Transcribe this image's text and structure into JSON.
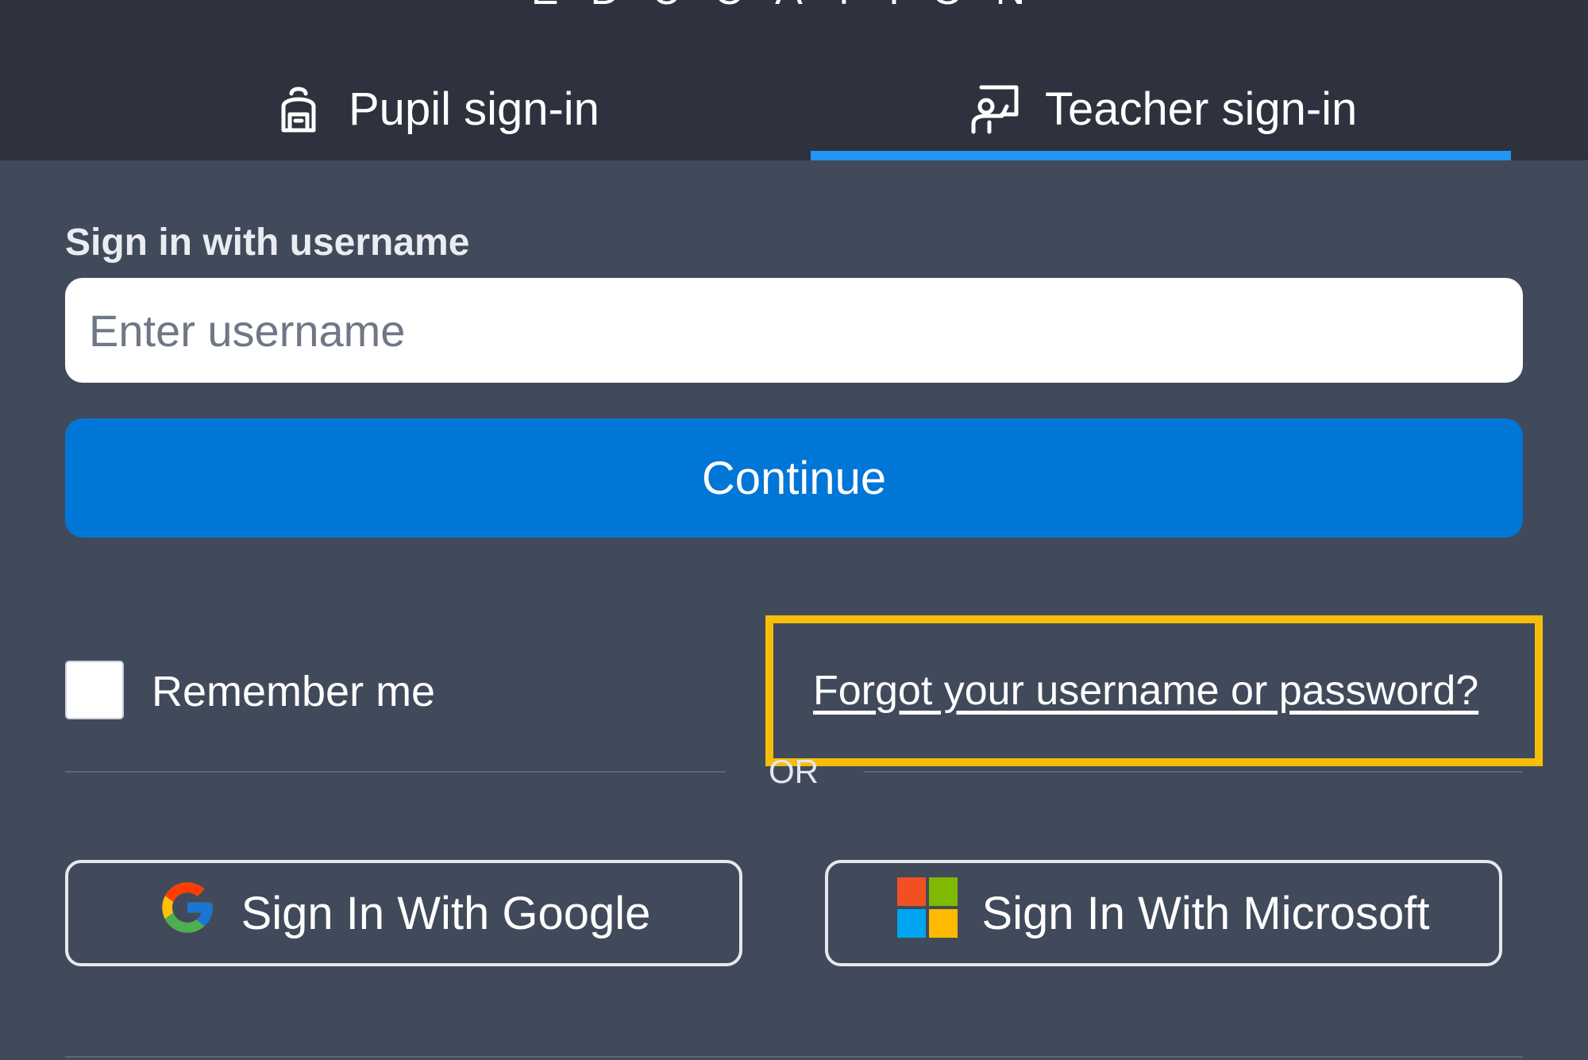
{
  "header": {
    "brand_text": "EDUCATION",
    "tabs": [
      {
        "label": "Pupil sign-in",
        "icon": "backpack-icon",
        "active": false
      },
      {
        "label": "Teacher sign-in",
        "icon": "teacher-board-icon",
        "active": true
      }
    ]
  },
  "form": {
    "label": "Sign in with username",
    "username_placeholder": "Enter username",
    "username_value": "",
    "continue_label": "Continue",
    "remember_label": "Remember me",
    "remember_checked": false,
    "forgot_link": "Forgot your username or password?",
    "or_text": "OR"
  },
  "sso": {
    "google_label": "Sign In With Google",
    "google_icon": "google-g-icon",
    "microsoft_label": "Sign In With Microsoft",
    "microsoft_icon": "microsoft-logo-icon"
  },
  "colors": {
    "header_bg": "#2d323e",
    "page_bg": "#414a5a",
    "accent_blue": "#0076d7",
    "tab_underline": "#2196f3",
    "highlight": "#f6bd0b"
  }
}
